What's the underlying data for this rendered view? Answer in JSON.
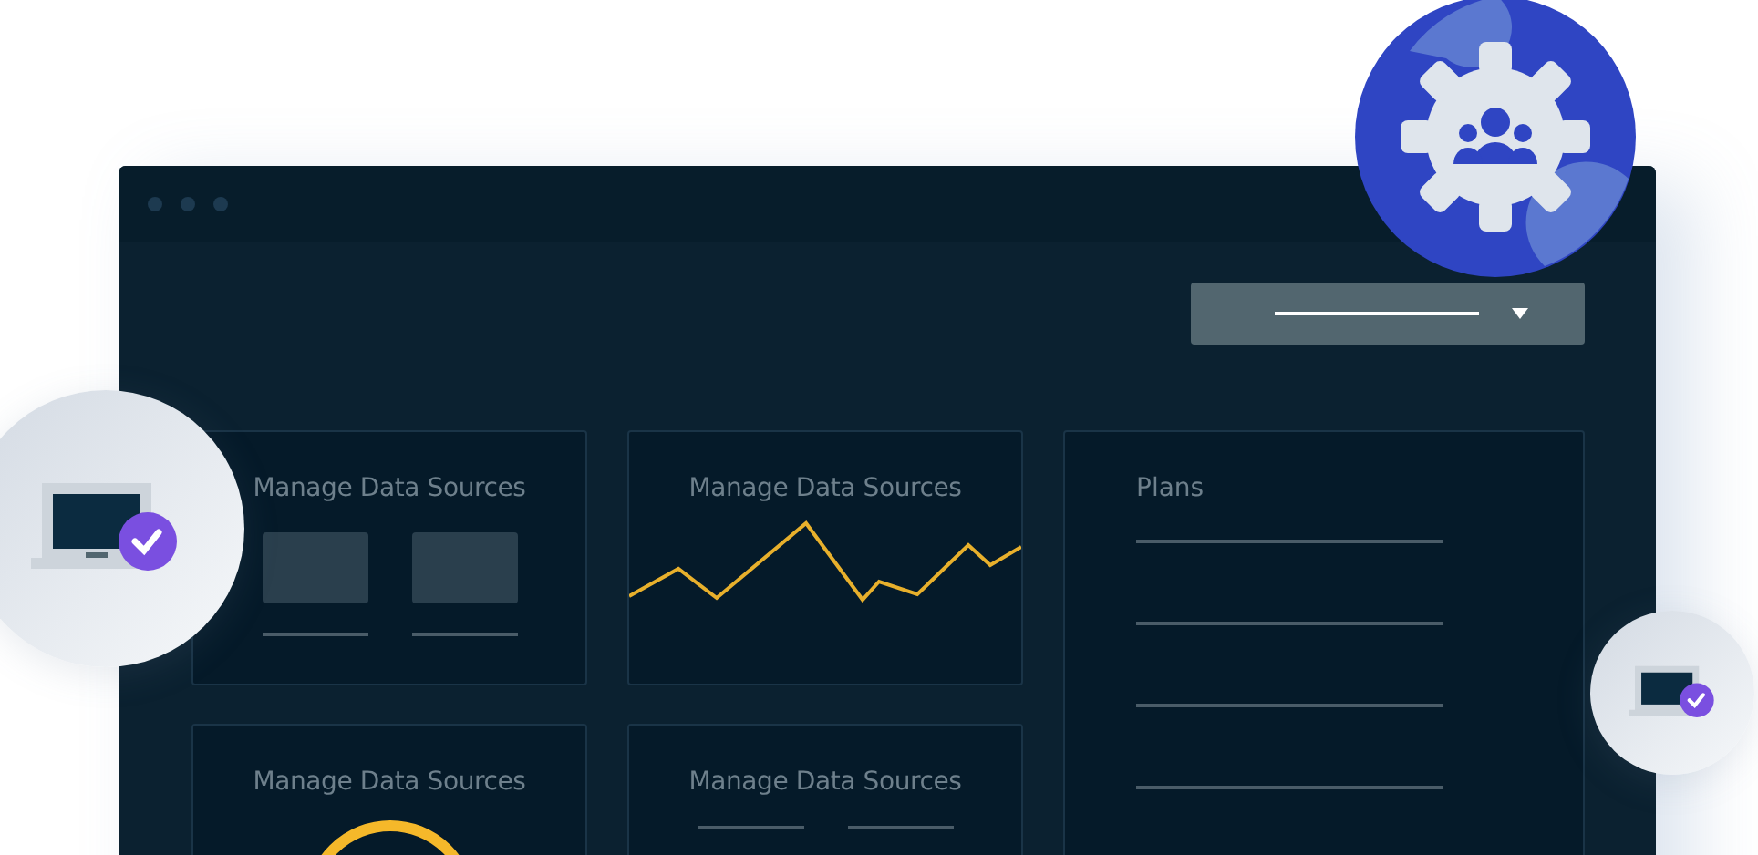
{
  "cards": [
    {
      "kind": "blocks",
      "title": "Manage Data Sources"
    },
    {
      "kind": "line",
      "title": "Manage Data Sources"
    },
    {
      "kind": "ring",
      "title": "Manage Data Sources"
    },
    {
      "kind": "lines",
      "title": "Manage Data Sources"
    }
  ],
  "plans": {
    "title": "Plans"
  }
}
